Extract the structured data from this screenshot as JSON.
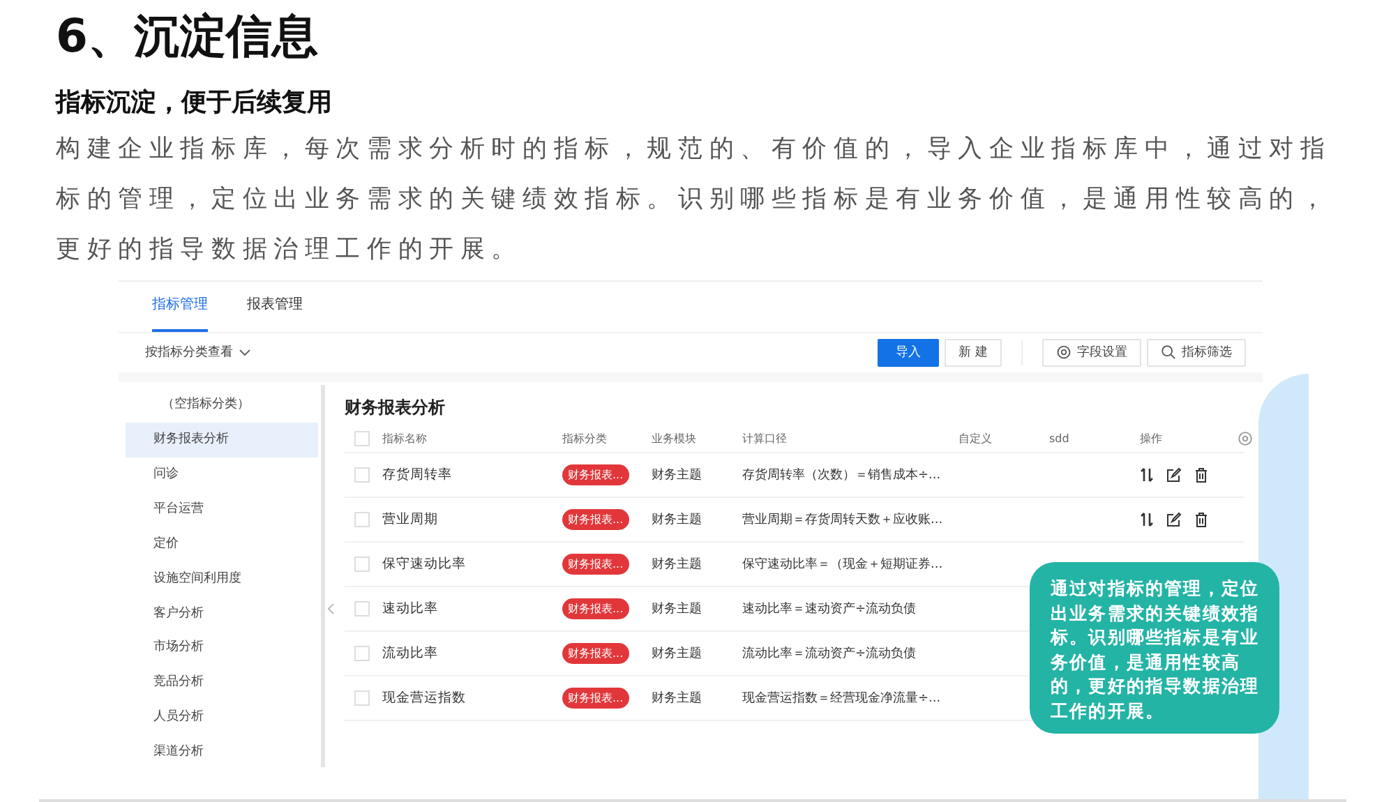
{
  "heading": "6、沉淀信息",
  "subheading": "指标沉淀，便于后续复用",
  "paragraph": "构建企业指标库，每次需求分析时的指标，规范的、有价值的，导入企业指标库中，通过对指标的管理，定位出业务需求的关键绩效指标。识别哪些指标是有业务价值，是通用性较高的，更好的指导数据治理工作的开展。",
  "app": {
    "tabs": [
      {
        "label": "指标管理",
        "selected": true
      },
      {
        "label": "报表管理",
        "selected": false
      }
    ],
    "view_selector": "按指标分类查看",
    "toolbar": {
      "import": "导入",
      "create": "新 建",
      "field_settings": "字段设置",
      "filter": "指标筛选"
    },
    "sidebar": {
      "items": [
        {
          "label": "（空指标分类）",
          "selected": false
        },
        {
          "label": "财务报表分析",
          "selected": true
        },
        {
          "label": "问诊",
          "selected": false
        },
        {
          "label": "平台运营",
          "selected": false
        },
        {
          "label": "定价",
          "selected": false
        },
        {
          "label": "设施空间利用度",
          "selected": false
        },
        {
          "label": "客户分析",
          "selected": false
        },
        {
          "label": "市场分析",
          "selected": false
        },
        {
          "label": "竞品分析",
          "selected": false
        },
        {
          "label": "人员分析",
          "selected": false
        },
        {
          "label": "渠道分析",
          "selected": false
        }
      ]
    },
    "table": {
      "title": "财务报表分析",
      "all_checked": false,
      "columns": [
        "指标名称",
        "指标分类",
        "业务模块",
        "计算口径",
        "自定义",
        "sdd",
        "操作"
      ],
      "rows": [
        {
          "name": "存货周转率",
          "category": "财务报表...",
          "module": "财务主题",
          "formula": "存货周转率（次数）＝销售成本÷...",
          "actions": true,
          "checked": false
        },
        {
          "name": "营业周期",
          "category": "财务报表...",
          "module": "财务主题",
          "formula": "营业周期＝存货周转天数＋应收账...",
          "actions": true,
          "checked": false
        },
        {
          "name": "保守速动比率",
          "category": "财务报表...",
          "module": "财务主题",
          "formula": "保守速动比率＝（现金＋短期证券...",
          "actions": false,
          "checked": false
        },
        {
          "name": "速动比率",
          "category": "财务报表...",
          "module": "财务主题",
          "formula": "速动比率＝速动资产÷流动负债",
          "actions": false,
          "checked": false
        },
        {
          "name": "流动比率",
          "category": "财务报表...",
          "module": "财务主题",
          "formula": "流动比率＝流动资产÷流动负债",
          "actions": false,
          "checked": false
        },
        {
          "name": "现金营运指数",
          "category": "财务报表...",
          "module": "财务主题",
          "formula": "现金营运指数＝经营现金净流量÷...",
          "actions": false,
          "checked": false
        }
      ]
    }
  },
  "callout": "通过对指标的管理，定位出业务需求的关键绩效指标。识别哪些指标是有业务价值，是通用性较高的，更好的指导数据治理工作的开展。"
}
